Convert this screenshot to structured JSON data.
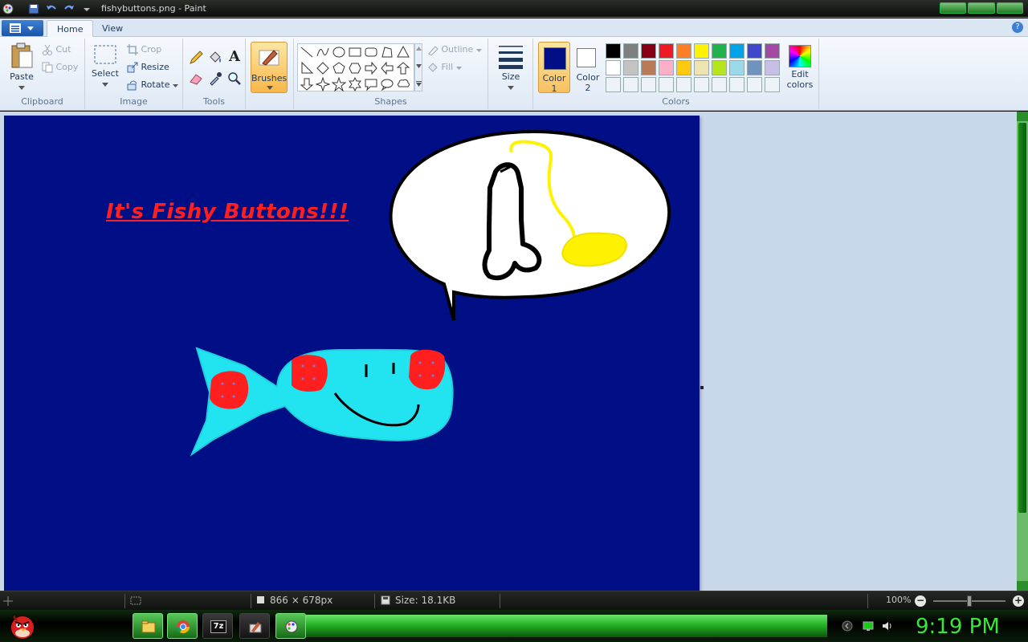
{
  "window": {
    "title": "fishybuttons.png - Paint"
  },
  "tabs": {
    "home": "Home",
    "view": "View"
  },
  "ribbon": {
    "clipboard": {
      "label": "Clipboard",
      "paste": "Paste",
      "cut": "Cut",
      "copy": "Copy"
    },
    "image": {
      "label": "Image",
      "select": "Select",
      "crop": "Crop",
      "resize": "Resize",
      "rotate": "Rotate"
    },
    "tools": {
      "label": "Tools",
      "text_glyph": "A"
    },
    "brushes": {
      "label": "Brushes"
    },
    "shapes": {
      "label": "Shapes",
      "outline": "Outline",
      "fill": "Fill"
    },
    "size": {
      "label": "Size"
    },
    "colors": {
      "label": "Colors",
      "color1_line1": "Color",
      "color1_line2": "1",
      "color2_line1": "Color",
      "color2_line2": "2",
      "edit_line1": "Edit",
      "edit_line2": "colors",
      "color1_value": "#000f85",
      "color2_value": "#ffffff",
      "palette_row1": [
        "#000000",
        "#7f7f7f",
        "#880015",
        "#ed1c24",
        "#ff7f27",
        "#fff200",
        "#22b14c",
        "#00a2e8",
        "#3f48cc",
        "#a349a4"
      ],
      "palette_row2": [
        "#ffffff",
        "#c3c3c3",
        "#b97a57",
        "#ffaec9",
        "#ffc90e",
        "#efe4b0",
        "#b5e61d",
        "#99d9ea",
        "#7092be",
        "#c8bfe7"
      ]
    }
  },
  "canvas": {
    "heading": "It's Fishy Buttons!!!",
    "background": "#000f85"
  },
  "status": {
    "dimensions": "866 × 678px",
    "size": "Size: 18.1KB",
    "zoom": "100%"
  },
  "taskbar": {
    "clock": "9:19 PM",
    "taskbar_7z": "7z"
  }
}
